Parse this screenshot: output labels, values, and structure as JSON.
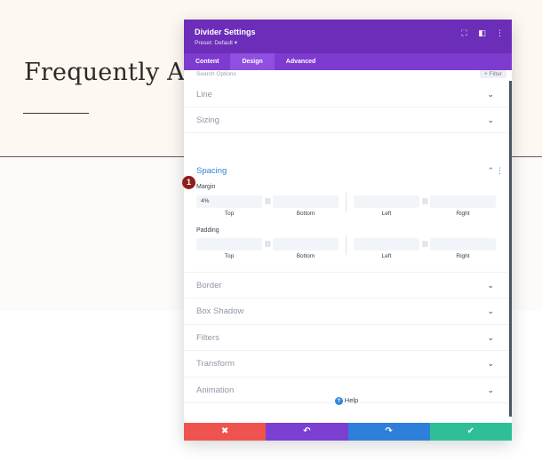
{
  "background": {
    "heading": "Frequently Ask",
    "colors": {
      "hero_bg": "#fdf8f2",
      "text": "#2f2a26"
    }
  },
  "modal": {
    "title": "Divider Settings",
    "preset": "Preset: Default ▾",
    "header_icons": [
      "expand-icon",
      "sidebar-icon",
      "more-icon"
    ],
    "tabs": [
      {
        "label": "Content",
        "active": false
      },
      {
        "label": "Design",
        "active": true
      },
      {
        "label": "Advanced",
        "active": false
      }
    ],
    "search": {
      "placeholder": "Search Options",
      "filter_label": "+ Filter"
    },
    "sections_top": [
      {
        "label": "Line"
      },
      {
        "label": "Sizing"
      }
    ],
    "spacing": {
      "label": "Spacing",
      "margin": {
        "label": "Margin",
        "top": "4%",
        "bottom": "",
        "left": "",
        "right": "",
        "labels": [
          "Top",
          "Bottom",
          "Left",
          "Right"
        ]
      },
      "padding": {
        "label": "Padding",
        "top": "",
        "bottom": "",
        "left": "",
        "right": "",
        "labels": [
          "Top",
          "Bottom",
          "Left",
          "Right"
        ]
      }
    },
    "sections_bottom": [
      {
        "label": "Border"
      },
      {
        "label": "Box Shadow"
      },
      {
        "label": "Filters"
      },
      {
        "label": "Transform"
      },
      {
        "label": "Animation"
      }
    ],
    "help_label": "Help",
    "step_badge": "1",
    "footer": [
      {
        "name": "cancel-button",
        "glyph": "✖",
        "color": "#ef5350"
      },
      {
        "name": "undo-button",
        "glyph": "↶",
        "color": "#7b3fd1"
      },
      {
        "name": "redo-button",
        "glyph": "↷",
        "color": "#2e7fd9"
      },
      {
        "name": "save-button",
        "glyph": "✔",
        "color": "#2ebf98"
      }
    ],
    "colors": {
      "header": "#6c2eb9",
      "tabs": "#7d3bcf",
      "accent": "#2b87da"
    }
  }
}
